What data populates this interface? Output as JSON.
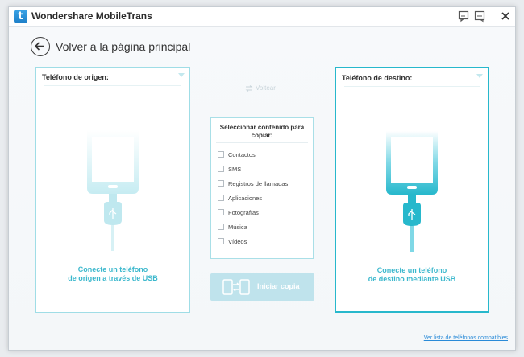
{
  "window": {
    "title": "Wondershare MobileTrans",
    "logo_letter": "t"
  },
  "titlebar_buttons": [
    "feedback-icon",
    "register-icon",
    "close-icon"
  ],
  "back": {
    "label": "Volver a la página principal"
  },
  "source_panel": {
    "title": "Teléfono de origen:",
    "caption_line1": "Conecte un teléfono",
    "caption_line2": "de origen a través de USB"
  },
  "flip": {
    "label": "Voltear"
  },
  "select": {
    "title_line1": "Seleccionar contenido para",
    "title_line2": "copiar:",
    "options": [
      {
        "label": "Contactos",
        "checked": false
      },
      {
        "label": "SMS",
        "checked": false
      },
      {
        "label": "Registros de llamadas",
        "checked": false
      },
      {
        "label": "Aplicaciones",
        "checked": false
      },
      {
        "label": "Fotografías",
        "checked": false
      },
      {
        "label": "Música",
        "checked": false
      },
      {
        "label": "Vídeos",
        "checked": false
      }
    ]
  },
  "start": {
    "label": "Iniciar copia"
  },
  "dest_panel": {
    "title": "Teléfono de destino:",
    "caption_line1": "Conecte un teléfono",
    "caption_line2": "de destino mediante USB"
  },
  "footer": {
    "compat_link": "Ver lista de teléfonos compatibles"
  },
  "colors": {
    "accent": "#27b8cc",
    "accent_light": "#a9dfe7",
    "caption": "#3cb8cd",
    "button_disabled": "#bfe3ec",
    "link": "#2a8bd8"
  }
}
